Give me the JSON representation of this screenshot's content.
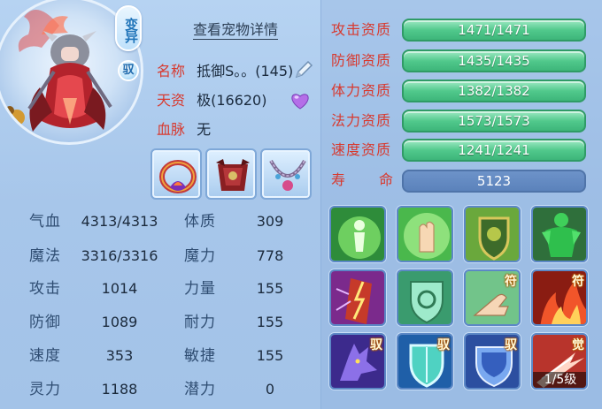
{
  "badges": {
    "variant": "变异",
    "tamed": "驭"
  },
  "header": {
    "detail_link": "查看宠物详情"
  },
  "pet_info": [
    {
      "label": "名称",
      "value": "抵御S。。(145)"
    },
    {
      "label": "天资",
      "value": "极(16620)"
    },
    {
      "label": "血脉",
      "value": "无"
    }
  ],
  "stats_left": [
    {
      "label": "气血",
      "value": "4313/4313"
    },
    {
      "label": "魔法",
      "value": "3316/3316"
    },
    {
      "label": "攻击",
      "value": "1014"
    },
    {
      "label": "防御",
      "value": "1089"
    },
    {
      "label": "速度",
      "value": "353"
    },
    {
      "label": "灵力",
      "value": "1188"
    }
  ],
  "stats_right": [
    {
      "label": "体质",
      "value": "309"
    },
    {
      "label": "魔力",
      "value": "778"
    },
    {
      "label": "力量",
      "value": "155"
    },
    {
      "label": "耐力",
      "value": "155"
    },
    {
      "label": "敏捷",
      "value": "155"
    },
    {
      "label": "潜力",
      "value": "0"
    }
  ],
  "aptitudes": [
    {
      "label": "攻击资质",
      "value": "1471/1471"
    },
    {
      "label": "防御资质",
      "value": "1435/1435"
    },
    {
      "label": "体力资质",
      "value": "1382/1382"
    },
    {
      "label": "法力资质",
      "value": "1573/1573"
    },
    {
      "label": "速度资质",
      "value": "1241/1241"
    }
  ],
  "lifespan": {
    "label_1": "寿",
    "label_2": "命",
    "value": "5123"
  },
  "skill_tags": {
    "fu": "符",
    "yu": "驭",
    "jue": "觉"
  },
  "awaken_level": "1/5级",
  "colors": {
    "label_red": "#d8392e",
    "aptitude_green": "#51c98c",
    "lifespan_blue": "#5b82bb",
    "panel_blue": "#a9c9ec"
  }
}
